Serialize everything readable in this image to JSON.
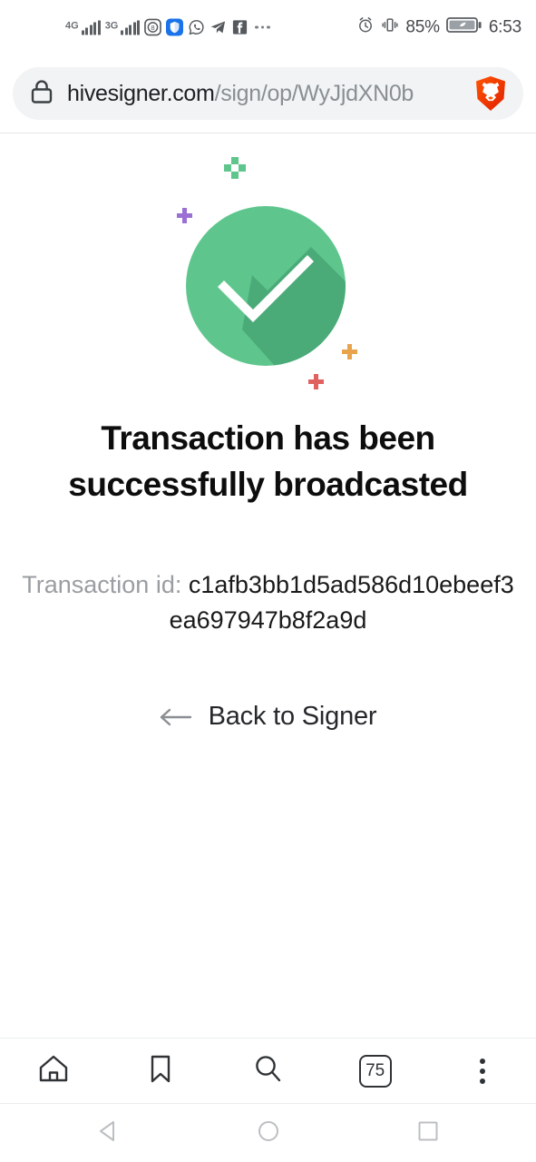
{
  "status_bar": {
    "networks": [
      {
        "label": "4G",
        "icon": "signal-bars-icon",
        "bars": 5
      },
      {
        "label": "3G",
        "icon": "signal-bars-icon",
        "bars": 5
      }
    ],
    "app_icons": [
      {
        "name": "eight-ball-badge-icon",
        "label": "8"
      },
      {
        "name": "shield-icon",
        "label": ""
      },
      {
        "name": "whatsapp-icon",
        "label": ""
      },
      {
        "name": "telegram-icon",
        "label": ""
      },
      {
        "name": "facebook-icon",
        "label": ""
      }
    ],
    "overflow_icon": "more-notifications-icon",
    "alarm_icon": "alarm-clock-icon",
    "vibrate_icon": "vibrate-icon",
    "battery_percent": "85%",
    "battery_icon": "battery-saver-leaf-icon",
    "clock": "6:53"
  },
  "browser": {
    "lock_icon": "lock-icon",
    "url_host": "hivesigner.com",
    "url_path": "/sign/op/WyJjdXN0b",
    "brand_icon": "brave-lion-icon",
    "toolbar": {
      "home_icon": "home-icon",
      "bookmark_icon": "bookmark-icon",
      "search_icon": "search-icon",
      "tab_count": "75",
      "menu_icon": "kebab-menu-icon"
    }
  },
  "page": {
    "illustration": {
      "name": "success-checkmark-icon",
      "circle_color": "#5ec68d",
      "shadow_color": "#4aab78",
      "check_color": "#ffffff",
      "sparkles": [
        {
          "name": "sparkle-green",
          "color": "#5ec68d"
        },
        {
          "name": "sparkle-purple",
          "color": "#9b6fd4"
        },
        {
          "name": "sparkle-orange",
          "color": "#e8a44c"
        },
        {
          "name": "sparkle-red",
          "color": "#e0625f"
        }
      ]
    },
    "title": "Transaction has been successfully broadcasted",
    "transaction_id_label": "Transaction id:",
    "transaction_id_value": "c1afb3bb1d5ad586d10ebeef3ea697947b8f2a9d",
    "back_link_label": "Back to Signer",
    "back_arrow_icon": "arrow-left-icon"
  },
  "android_nav": {
    "back_icon": "nav-back-triangle-icon",
    "home_icon": "nav-home-circle-icon",
    "recents_icon": "nav-recents-square-icon"
  }
}
